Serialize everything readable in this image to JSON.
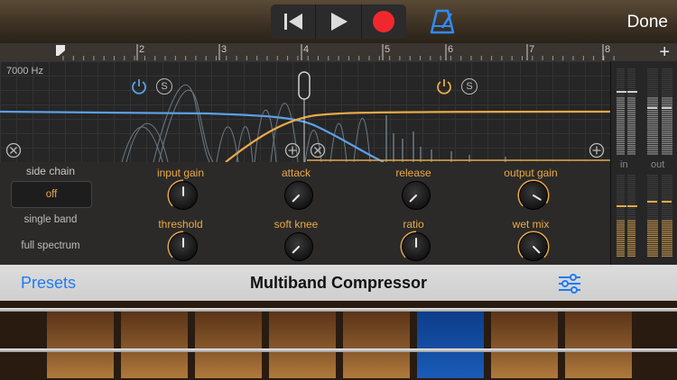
{
  "header": {
    "done_label": "Done",
    "transport": [
      "rewind-icon",
      "play-icon",
      "record-icon"
    ],
    "metronome_icon": "metronome-icon",
    "add_label": "+"
  },
  "ruler": {
    "marks": [
      "2",
      "3",
      "4",
      "5",
      "6",
      "7",
      "8"
    ]
  },
  "graph": {
    "frequency_label": "7000 Hz"
  },
  "band_low": {
    "solo_label": "S",
    "color": "#5ba0e6"
  },
  "band_high": {
    "solo_label": "S",
    "color": "#e9a948"
  },
  "side_chain": {
    "title": "side chain",
    "options": [
      "off",
      "single band",
      "full spectrum"
    ],
    "selected": "off"
  },
  "knobs": {
    "input_gain": {
      "label": "input gain",
      "value": 0.5
    },
    "attack": {
      "label": "attack",
      "value": 0.0
    },
    "release": {
      "label": "release",
      "value": 0.0
    },
    "output_gain": {
      "label": "output gain",
      "value": 0.95
    },
    "threshold": {
      "label": "threshold",
      "value": 0.5
    },
    "soft_knee": {
      "label": "soft knee",
      "value": 0.0
    },
    "ratio": {
      "label": "ratio",
      "value": 0.5
    },
    "wet_mix": {
      "label": "wet mix",
      "value": 1.0
    }
  },
  "meters": {
    "in_label": "in",
    "out_label": "out"
  },
  "bottom": {
    "presets_label": "Presets",
    "title": "Multiband Compressor",
    "settings_icon": "sliders-icon"
  },
  "colors": {
    "accent": "#e9a948",
    "link": "#1e7cf5",
    "record": "#f0282e",
    "low_band": "#5ba0e6"
  }
}
